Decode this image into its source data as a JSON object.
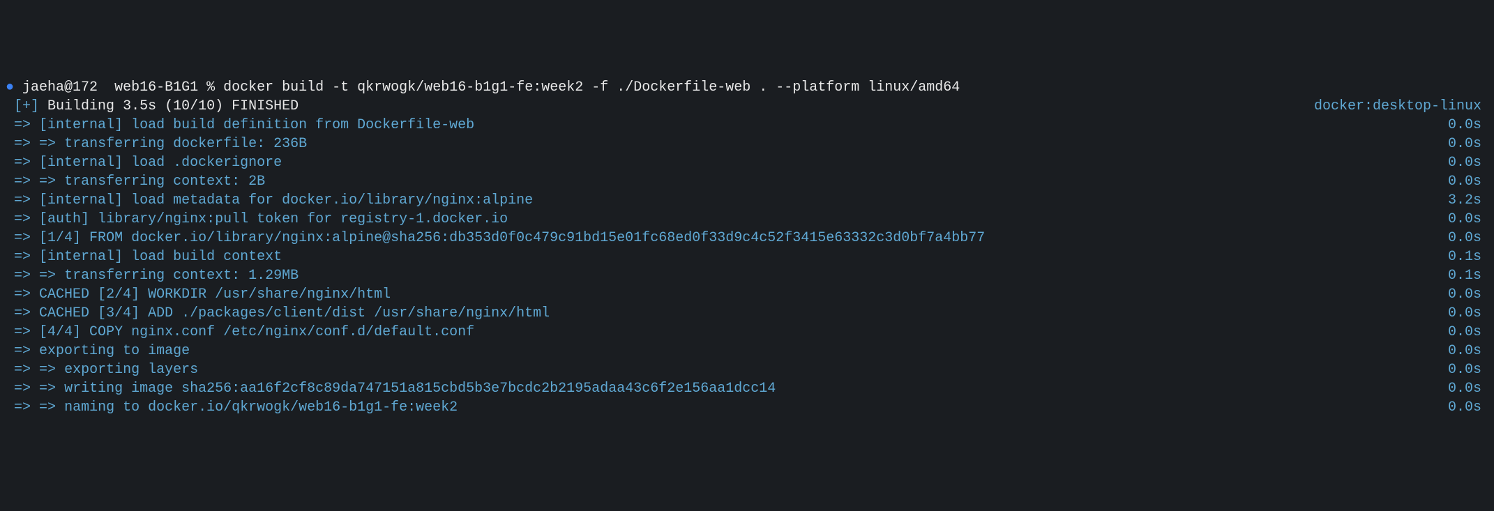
{
  "prompt": {
    "dot": "●",
    "user_host": "jaeha@172",
    "dir": "web16-B1G1",
    "sep": "%",
    "command": "docker build -t qkrwogk/web16-b1g1-fe:week2 -f ./Dockerfile-web . --platform linux/amd64"
  },
  "header": {
    "prefix": "[+]",
    "text": "Building 3.5s (10/10) FINISHED",
    "context": "docker:desktop-linux"
  },
  "lines": [
    {
      "arrow": "=>",
      "sub": "",
      "text": "[internal] load build definition from Dockerfile-web",
      "time": "0.0s"
    },
    {
      "arrow": "=>",
      "sub": "=> ",
      "text": "transferring dockerfile: 236B",
      "time": "0.0s"
    },
    {
      "arrow": "=>",
      "sub": "",
      "text": "[internal] load .dockerignore",
      "time": "0.0s"
    },
    {
      "arrow": "=>",
      "sub": "=> ",
      "text": "transferring context: 2B",
      "time": "0.0s"
    },
    {
      "arrow": "=>",
      "sub": "",
      "text": "[internal] load metadata for docker.io/library/nginx:alpine",
      "time": "3.2s"
    },
    {
      "arrow": "=>",
      "sub": "",
      "text": "[auth] library/nginx:pull token for registry-1.docker.io",
      "time": "0.0s"
    },
    {
      "arrow": "=>",
      "sub": "",
      "text": "[1/4] FROM docker.io/library/nginx:alpine@sha256:db353d0f0c479c91bd15e01fc68ed0f33d9c4c52f3415e63332c3d0bf7a4bb77",
      "time": "0.0s"
    },
    {
      "arrow": "=>",
      "sub": "",
      "text": "[internal] load build context",
      "time": "0.1s"
    },
    {
      "arrow": "=>",
      "sub": "=> ",
      "text": "transferring context: 1.29MB",
      "time": "0.1s"
    },
    {
      "arrow": "=>",
      "sub": "",
      "text": "CACHED [2/4] WORKDIR /usr/share/nginx/html",
      "time": "0.0s"
    },
    {
      "arrow": "=>",
      "sub": "",
      "text": "CACHED [3/4] ADD ./packages/client/dist /usr/share/nginx/html",
      "time": "0.0s"
    },
    {
      "arrow": "=>",
      "sub": "",
      "text": "[4/4] COPY nginx.conf /etc/nginx/conf.d/default.conf",
      "time": "0.0s"
    },
    {
      "arrow": "=>",
      "sub": "",
      "text": "exporting to image",
      "time": "0.0s"
    },
    {
      "arrow": "=>",
      "sub": "=> ",
      "text": "exporting layers",
      "time": "0.0s"
    },
    {
      "arrow": "=>",
      "sub": "=> ",
      "text": "writing image sha256:aa16f2cf8c89da747151a815cbd5b3e7bcdc2b2195adaa43c6f2e156aa1dcc14",
      "time": "0.0s"
    },
    {
      "arrow": "=>",
      "sub": "=> ",
      "text": "naming to docker.io/qkrwogk/web16-b1g1-fe:week2",
      "time": "0.0s"
    }
  ]
}
